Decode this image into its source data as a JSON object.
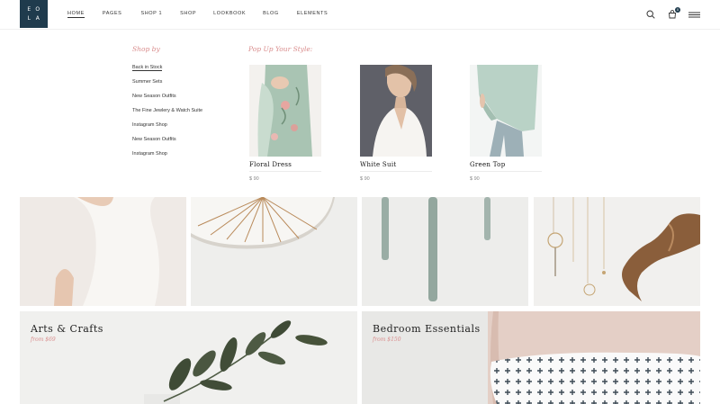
{
  "header": {
    "logo_letters": [
      "E",
      "O",
      "L",
      "A"
    ],
    "nav": [
      {
        "label": "Home"
      },
      {
        "label": "Pages"
      },
      {
        "label": "Shop 1"
      },
      {
        "label": "Shop"
      },
      {
        "label": "Lookbook"
      },
      {
        "label": "Blog"
      },
      {
        "label": "Elements"
      }
    ],
    "cart_count": "0"
  },
  "mega_menu": {
    "shop_by_title": "Shop by",
    "shop_by_items": [
      "Back in Stock",
      "Summer Sets",
      "New Season Outfits",
      "The Fine Jewlery & Watch Suite",
      "Instagram Shop",
      "New Season Outfits",
      "Instagram Shop"
    ],
    "popup_title": "Pop Up Your Style:",
    "products": [
      {
        "name": "Floral Dress",
        "price": "$ 90"
      },
      {
        "name": "White Suit",
        "price": "$ 90"
      },
      {
        "name": "Green Top",
        "price": "$ 90"
      }
    ]
  },
  "categories": [
    {
      "title": "Arts & Crafts",
      "subtitle": "from $69"
    },
    {
      "title": "Bedroom Essentials",
      "subtitle": "from $150"
    }
  ],
  "colors": {
    "brand": "#1f3b4d",
    "accent": "#d98c8c"
  }
}
